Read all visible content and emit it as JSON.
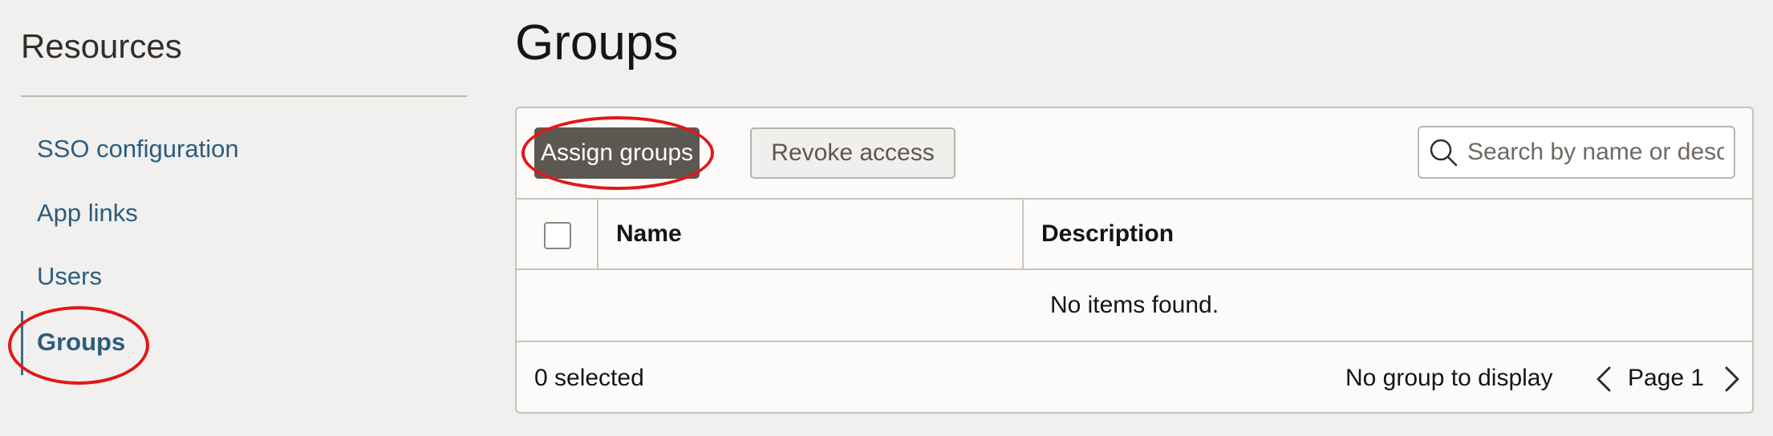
{
  "sidebar": {
    "title": "Resources",
    "items": [
      {
        "label": "SSO configuration",
        "active": false
      },
      {
        "label": "App links",
        "active": false
      },
      {
        "label": "Users",
        "active": false
      },
      {
        "label": "Groups",
        "active": true
      }
    ]
  },
  "page": {
    "title": "Groups"
  },
  "toolbar": {
    "assign_label": "Assign groups",
    "revoke_label": "Revoke access"
  },
  "search": {
    "placeholder": "Search by name or description",
    "icon": "search-icon"
  },
  "table": {
    "columns": [
      "Name",
      "Description"
    ],
    "empty_message": "No items found."
  },
  "footer": {
    "selected_text": "0 selected",
    "status_text": "No group to display",
    "page_label": "Page 1"
  },
  "colors": {
    "link": "#2c5c7f",
    "primary_button": "#5d5752",
    "highlight": "#e01818"
  }
}
